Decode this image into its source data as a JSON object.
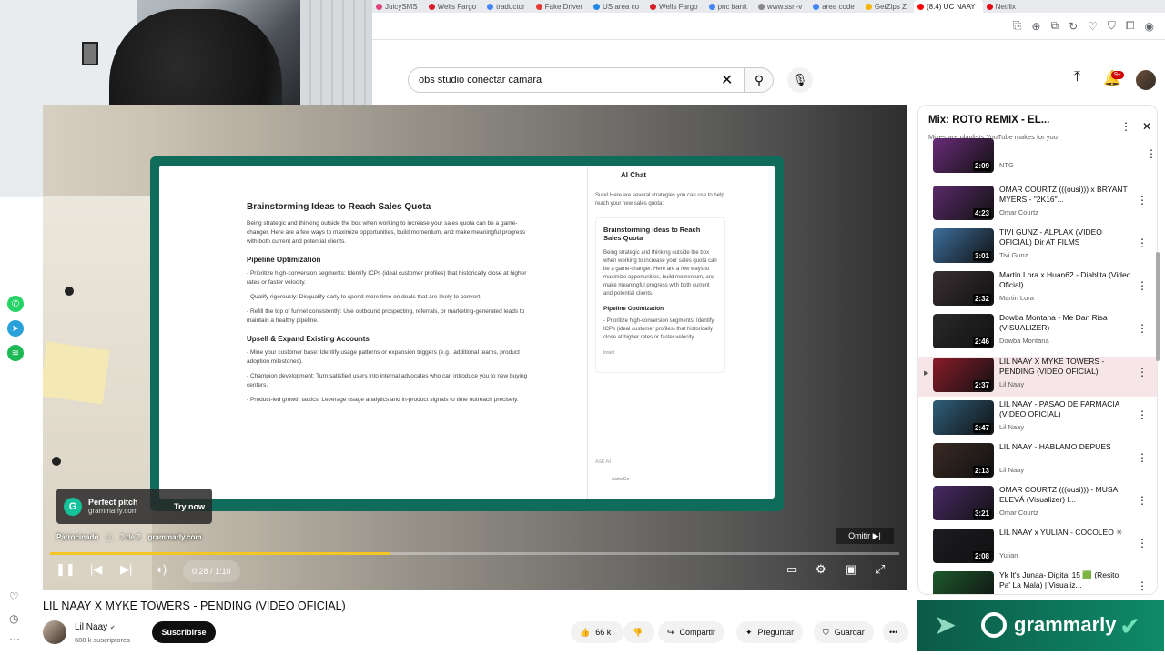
{
  "browser": {
    "tabs": [
      {
        "label": "JuicySMS",
        "color": "#e0457b"
      },
      {
        "label": "Wells Fargo",
        "color": "#d71e28"
      },
      {
        "label": "traductor",
        "color": "#4285f4"
      },
      {
        "label": "Fake Driver",
        "color": "#e53935"
      },
      {
        "label": "US area co",
        "color": "#1e88e5"
      },
      {
        "label": "Wells Fargo",
        "color": "#d71e28"
      },
      {
        "label": "pnc bank",
        "color": "#4285f4"
      },
      {
        "label": "www.ssn-v",
        "color": "#888888"
      },
      {
        "label": "area code",
        "color": "#4285f4"
      },
      {
        "label": "GetZips Z",
        "color": "#f4b400"
      },
      {
        "label": "(8.4) UC NAAY",
        "color": "#ff0000"
      },
      {
        "label": "Netflix",
        "color": "#e50914"
      }
    ],
    "toolbar_icons": [
      "translate-icon",
      "extension-icon",
      "screenshot-icon",
      "refresh-icon",
      "heart-icon",
      "shield-icon",
      "puzzle-icon",
      "profile-icon"
    ]
  },
  "masthead": {
    "search_value": "obs studio conectar camara",
    "clear_icon": "✕",
    "search_icon": "⚲",
    "mic_icon": "🎙",
    "upload_icon": "⤒",
    "notifications_badge": "9+"
  },
  "left_rail": {
    "apps": [
      {
        "name": "whatsapp-icon",
        "color": "#25d366",
        "glyph": "✆"
      },
      {
        "name": "telegram-icon",
        "color": "#2aa1da",
        "glyph": "➤"
      },
      {
        "name": "spotify-icon",
        "color": "#1db954",
        "glyph": "≋"
      }
    ],
    "heart": "♡",
    "history": "◷",
    "more": "···"
  },
  "player": {
    "ad_title": "Perfect pitch",
    "ad_domain": "grammarly.com",
    "ad_cta": "Try now",
    "sponsored": "Patrocinado",
    "ad_count": "2 de 2",
    "ad_site": "grammarly.com",
    "skip": "Omitir",
    "time": "0:28 / 1:10",
    "progress": 0.4,
    "doc": {
      "title": "Brainstorming Ideas to Reach Sales Quota",
      "intro": "Being strategic and thinking outside the box when working to increase your sales quota can be a game-changer. Here are a few ways to maximize opportunities, build momentum, and make meaningful progress with both current and potential clients.",
      "h1": "Pipeline Optimization",
      "p1": "- Prioritize high-conversion segments: Identify ICPs (ideal customer profiles) that historically close at higher rates or faster velocity.",
      "p2": "- Qualify rigorously: Disqualify early to spend more time on deals that are likely to convert.",
      "p3": "- Refill the top of funnel consistently: Use outbound prospecting, referrals, or marketing-generated leads to maintain a healthy pipeline.",
      "h2": "Upsell & Expand Existing Accounts",
      "p4": "- Mine your customer base: Identify usage patterns or expansion triggers (e.g., additional teams, product adoption milestones).",
      "p5": "- Champion development: Turn satisfied users into internal advocates who can introduce you to new buying centers.",
      "p6": "- Product-led growth tactics: Leverage usage analytics and in-product signals to time outreach precisely."
    },
    "chat": {
      "title": "AI Chat",
      "intro": "Sure! Here are several strategies you can use to help reach your new sales quota:",
      "card_title": "Brainstorming Ideas to Reach Sales Quota",
      "card_body": "Being strategic and thinking outside the box when working to increase your sales quota can be a game-changer. Here are a few ways to maximize opportunities, build momentum, and make meaningful progress with both current and potential clients.",
      "card_h": "Pipeline Optimization",
      "card_p": "- Prioritize high-conversion segments: Identify ICPs (ideal customer profiles) that historically close at higher rates or faster velocity.",
      "insert": "Insert",
      "ask": "Ask AI",
      "footer": "AcmeCo"
    }
  },
  "playlist": {
    "title": "Mix: ROTO REMIX - EL...",
    "subtitle": "Mixes are playlists YouTube makes for you",
    "items": [
      {
        "title": "",
        "channel": "NTG",
        "duration": "2:09",
        "color": "#6a2c7a",
        "active": false
      },
      {
        "title": "OMAR COURTZ (((ousi))) x BRYANT MYERS - \"2K16\"...",
        "channel": "Omar Courtz",
        "duration": "4:23",
        "color": "#5b2a6b",
        "active": false
      },
      {
        "title": "TIVI GUNZ - ALPLAX (VIDEO OFICIAL) Dir AT FILMS",
        "channel": "Tivi Gunz",
        "duration": "3:01",
        "color": "#3d6f9e",
        "active": false
      },
      {
        "title": "Martin Lora x Huan62 - Diablita (Video Oficial)",
        "channel": "Martin Lora",
        "duration": "2:32",
        "color": "#3a3032",
        "active": false
      },
      {
        "title": "Dowba Montana - Me Dan Risa (VISUALIZER)",
        "channel": "Dowba Montana",
        "duration": "2:46",
        "color": "#2a2a2a",
        "active": false
      },
      {
        "title": "LIL NAAY X MYKE TOWERS - PENDING (VIDEO OFICIAL)",
        "channel": "Lil Naay",
        "duration": "2:37",
        "color": "#8a1c2a",
        "active": true
      },
      {
        "title": "LIL NAAY - PASAO DE FARMACIA (VIDEO OFICIAL)",
        "channel": "Lil Naay",
        "duration": "2:47",
        "color": "#2f5f7a",
        "active": false
      },
      {
        "title": "LIL NAAY - HABLAMO DEPUES",
        "channel": "Lil Naay",
        "duration": "2:13",
        "color": "#3a2a24",
        "active": false
      },
      {
        "title": "OMAR COURTZ (((ousi))) - MUSA ELEVÁ (Visualizer) I...",
        "channel": "Omar Courtz",
        "duration": "3:21",
        "color": "#4a2a66",
        "active": false
      },
      {
        "title": "LIL NAAY x YULIAN - COCOLEO ✳",
        "channel": "Yulian",
        "duration": "2:08",
        "color": "#1c1c22",
        "active": false
      },
      {
        "title": "Yk It's Junaa- Digital 15 🟩 (Resito Pa' La Mala) | Visualiz...",
        "channel": "",
        "duration": "",
        "color": "#1d5a2c",
        "active": false
      }
    ]
  },
  "video": {
    "title": "LIL NAAY X MYKE TOWERS - PENDING (VIDEO OFICIAL)",
    "channel": "Lil Naay",
    "verified": "✔",
    "subscribers": "688 k suscriptores",
    "subscribe": "Suscribirse",
    "likes": "66 k",
    "share": "Compartir",
    "ask": "Preguntar",
    "save": "Guardar"
  },
  "banner": {
    "brand": "grammarly"
  }
}
